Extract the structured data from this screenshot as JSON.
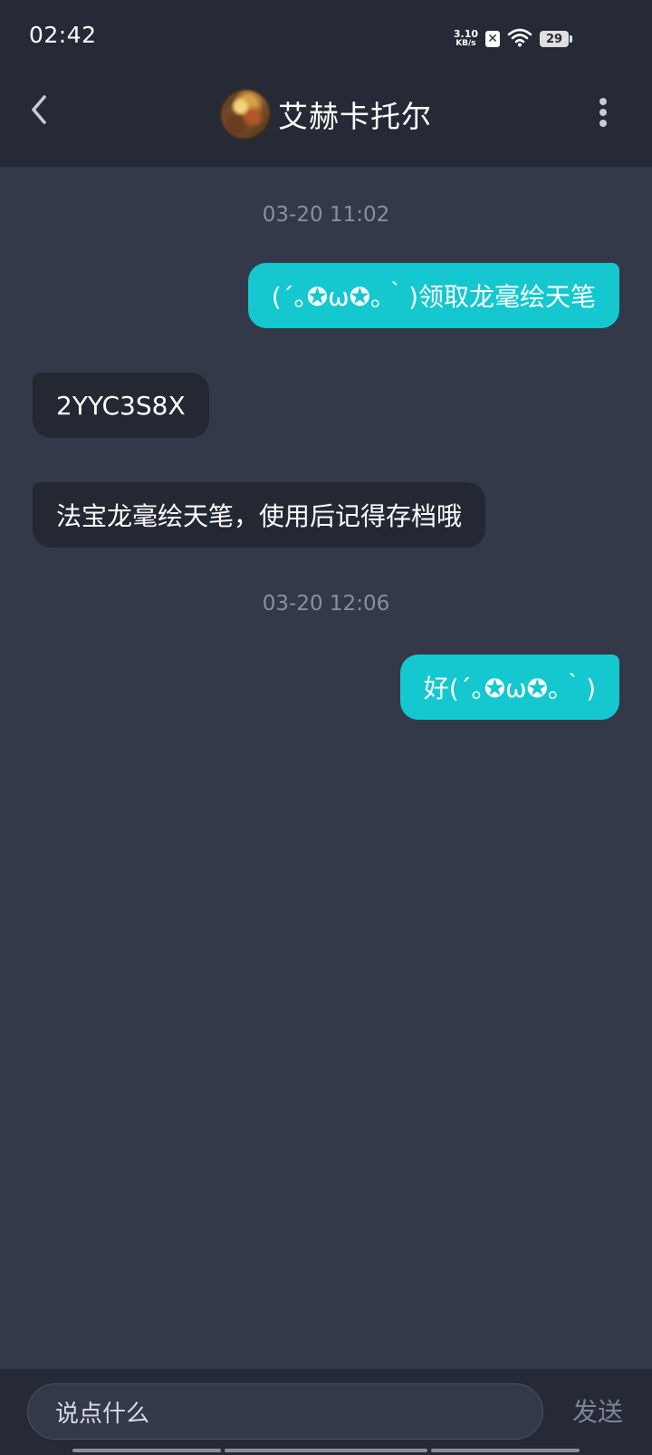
{
  "status_bar": {
    "time": "02:42",
    "net_speed_value": "3.10",
    "net_speed_unit": "KB/s",
    "x_badge": "✕",
    "battery": "29"
  },
  "header": {
    "back_icon": "chevron-left-icon",
    "title": "艾赫卡托尔",
    "more_icon": "more-vertical-icon"
  },
  "messages": [
    {
      "type": "timestamp",
      "text": "03-20 11:02"
    },
    {
      "type": "out",
      "text": "(´｡✪ω✪｡｀)领取龙毫绘天笔"
    },
    {
      "type": "in",
      "text": "2YYC3S8X"
    },
    {
      "type": "in",
      "text": "法宝龙毫绘天笔，使用后记得存档哦"
    },
    {
      "type": "timestamp",
      "text": "03-20 12:06"
    },
    {
      "type": "out",
      "text": "好(´｡✪ω✪｡｀)"
    }
  ],
  "composer": {
    "placeholder": "说点什么",
    "send_label": "发送"
  },
  "colors": {
    "outgoing_bubble": "#15c7cf",
    "incoming_bubble": "#242833",
    "background": "#343949",
    "bar": "#262a36"
  }
}
